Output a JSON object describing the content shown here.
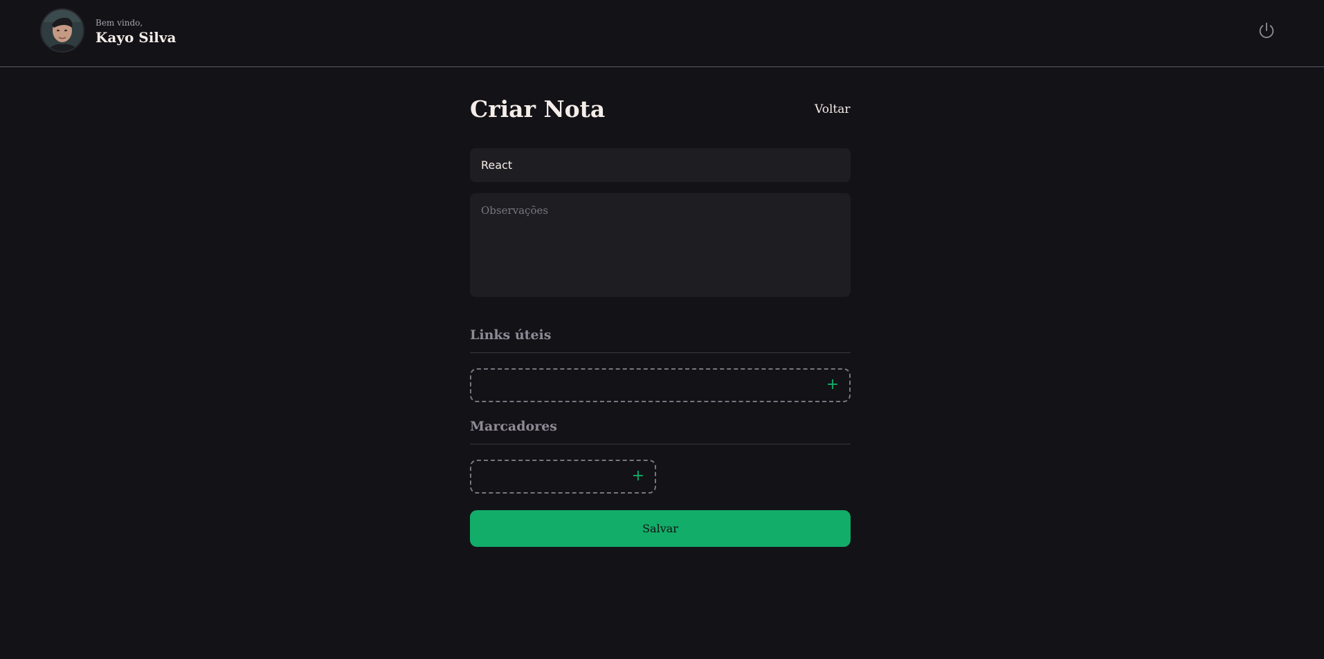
{
  "header": {
    "welcome_text": "Bem vindo,",
    "user_name": "Kayo Silva",
    "avatar_icon": "user-avatar",
    "logout_icon": "power-icon"
  },
  "page": {
    "title": "Criar Nota",
    "back_label": "Voltar"
  },
  "form": {
    "title_value": "React",
    "notes_placeholder": "Observações",
    "links_section": "Links úteis",
    "tags_section": "Marcadores",
    "add_icon": "plus",
    "save_label": "Salvar"
  },
  "colors": {
    "background": "#131217",
    "input_bg": "#1e1d22",
    "accent": "#12ad68",
    "text": "#f4ede8",
    "muted": "#8f8b96"
  }
}
